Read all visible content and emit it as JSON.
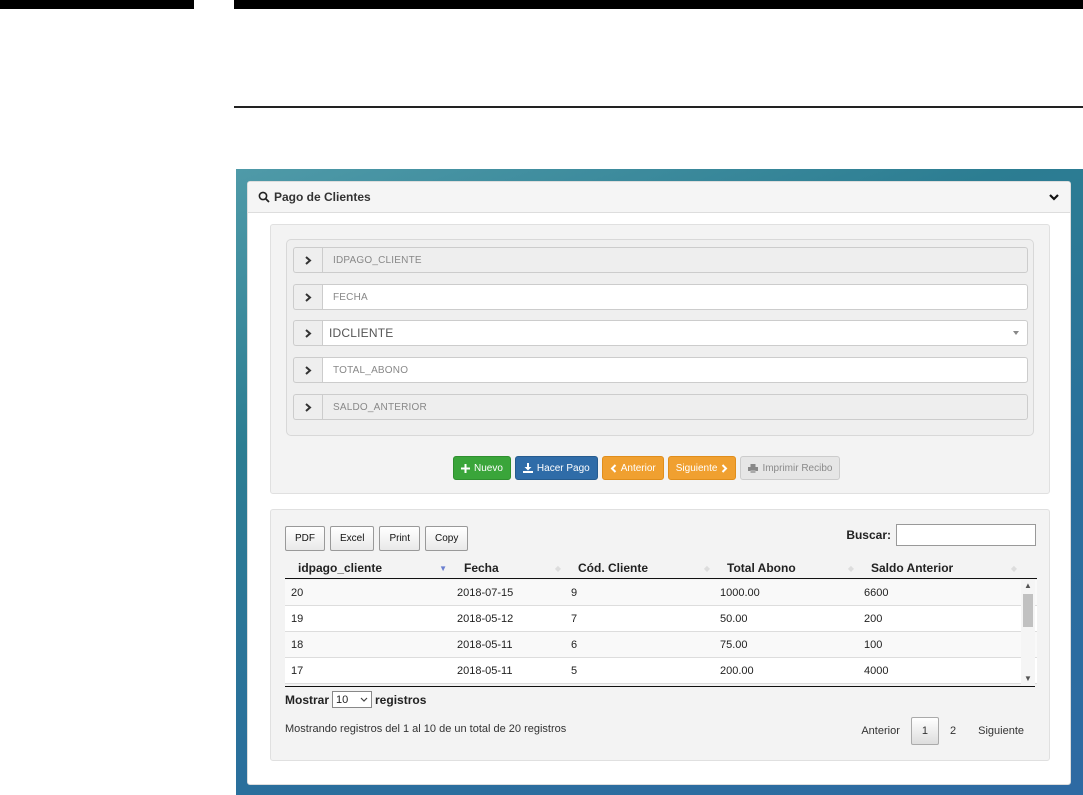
{
  "panel": {
    "title": "Pago de Clientes"
  },
  "form": {
    "fields": [
      {
        "name": "idpago",
        "placeholder": "IDPAGO_CLIENTE",
        "disabled": true
      },
      {
        "name": "fecha",
        "placeholder": "FECHA",
        "disabled": false
      },
      {
        "name": "idcliente",
        "value": "IDCLIENTE",
        "type": "select"
      },
      {
        "name": "total",
        "placeholder": "TOTAL_ABONO",
        "disabled": false
      },
      {
        "name": "saldo",
        "placeholder": "SALDO_ANTERIOR",
        "disabled": true
      }
    ],
    "buttons": {
      "nuevo": "Nuevo",
      "hacer_pago": "Hacer Pago",
      "anterior": "Anterior",
      "siguiente": "Siguiente",
      "imprimir": "Imprimir Recibo"
    }
  },
  "table": {
    "export_buttons": [
      "PDF",
      "Excel",
      "Print",
      "Copy"
    ],
    "search_label": "Buscar:",
    "columns": [
      "idpago_cliente",
      "Fecha",
      "Cód. Cliente",
      "Total Abono",
      "Saldo Anterior"
    ],
    "rows": [
      [
        "20",
        "2018-07-15",
        "9",
        "1000.00",
        "6600"
      ],
      [
        "19",
        "2018-05-12",
        "7",
        "50.00",
        "200"
      ],
      [
        "18",
        "2018-05-11",
        "6",
        "75.00",
        "100"
      ],
      [
        "17",
        "2018-05-11",
        "5",
        "200.00",
        "4000"
      ]
    ],
    "length_label_pre": "Mostrar",
    "length_value": "10",
    "length_label_post": "registros",
    "info": "Mostrando registros del 1 al 10 de un total de 20 registros",
    "pager": {
      "prev": "Anterior",
      "pages": [
        "1",
        "2"
      ],
      "next": "Siguiente",
      "current": "1"
    }
  },
  "colors": {
    "green": "#3aa53a",
    "blue": "#2f6ca8",
    "orange": "#f0a030"
  }
}
